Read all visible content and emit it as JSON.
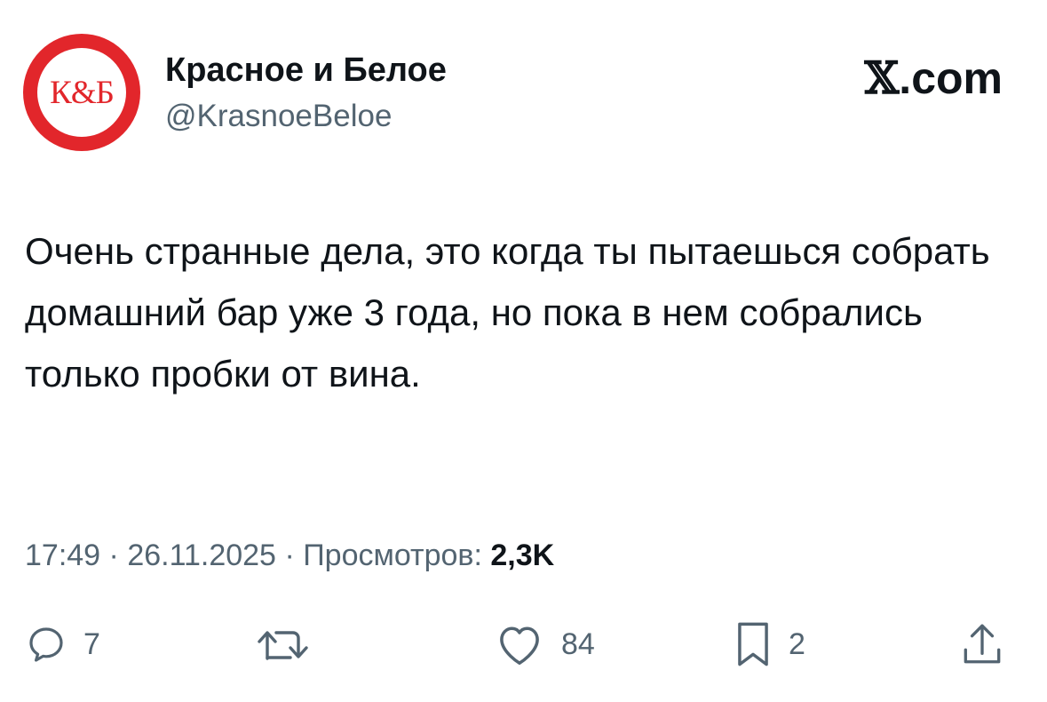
{
  "tweet": {
    "author": {
      "display_name": "Красное и Белое",
      "handle": "@KrasnoeBeloe",
      "avatar_text": "К&Б"
    },
    "brand": {
      "x_glyph": "𝕏",
      "suffix": ".com"
    },
    "text": "Очень странные дела, это когда ты пытаешься собрать домашний бар уже 3 года, но пока в нем собрались только пробки от вина.",
    "meta": {
      "time": "17:49",
      "separator": "·",
      "date": "26.11.2025",
      "views_label": "Просмотров:",
      "views_value": "2,3K"
    },
    "actions": {
      "reply": {
        "icon": "reply-icon",
        "count": "7"
      },
      "retweet": {
        "icon": "retweet-icon",
        "count": ""
      },
      "like": {
        "icon": "heart-icon",
        "count": "84"
      },
      "bookmark": {
        "icon": "bookmark-icon",
        "count": "2"
      },
      "share": {
        "icon": "share-icon"
      }
    }
  },
  "colors": {
    "text": "#0f1419",
    "secondary": "#536471",
    "brand_red": "#e2262b",
    "background": "#ffffff"
  }
}
